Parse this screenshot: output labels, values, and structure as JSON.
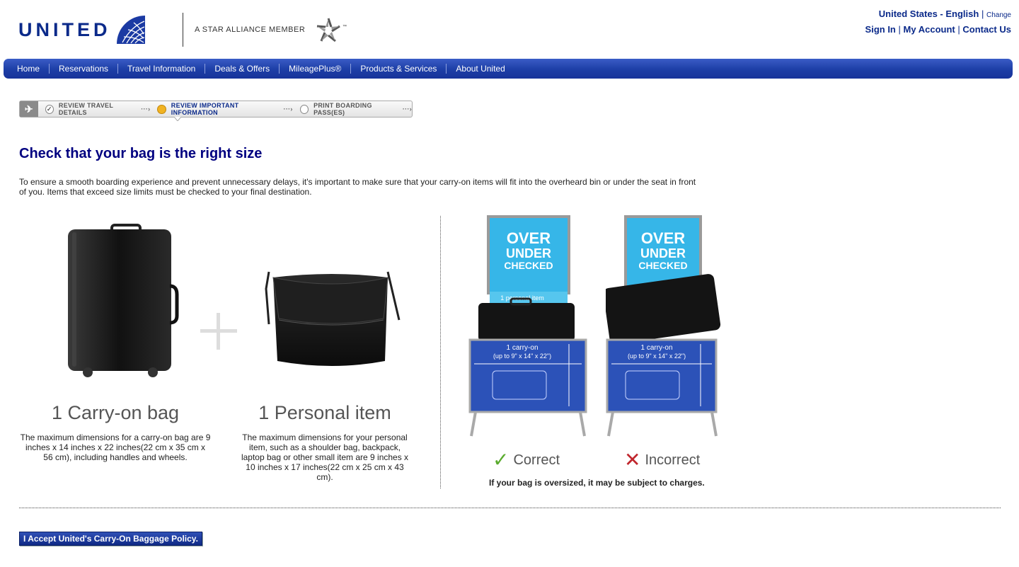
{
  "brand": {
    "name": "UNITED",
    "alliance": "A STAR ALLIANCE MEMBER",
    "tm": "™"
  },
  "top_links": {
    "locale": "United States - English",
    "change": "Change",
    "sign_in": "Sign In",
    "my_account": "My Account",
    "contact_us": "Contact Us",
    "separator": "|"
  },
  "nav": [
    "Home",
    "Reservations",
    "Travel Information",
    "Deals & Offers",
    "MileagePlus®",
    "Products & Services",
    "About United"
  ],
  "progress": {
    "steps": [
      {
        "label": "REVIEW TRAVEL DETAILS",
        "state": "done"
      },
      {
        "label": "REVIEW IMPORTANT INFORMATION",
        "state": "active"
      },
      {
        "label": "PRINT BOARDING PASS(ES)",
        "state": "pending"
      }
    ],
    "arrow": "···›"
  },
  "page": {
    "title": "Check that your bag is the right size",
    "intro": "To ensure a smooth boarding experience and prevent unnecessary delays, it's important to make sure that your carry-on items will fit into the overheard bin or under the seat in front of you. Items that exceed size limits must be checked to your final destination."
  },
  "carry_on": {
    "heading": "1 Carry-on bag",
    "desc": "The maximum dimensions for a carry-on bag are 9 inches x 14 inches x 22 inches(22 cm x 35 cm x 56 cm), including handles and wheels."
  },
  "personal": {
    "heading": "1 Personal item",
    "desc": "The maximum dimensions for your personal item, such as a shoulder bag, backpack, laptop bag or other small item are 9 inches x 10 inches x 17 inches(22 cm x 25 cm x 43 cm)."
  },
  "sizer": {
    "sign_over": "OVER",
    "sign_under": "UNDER",
    "sign_checked": "CHECKED",
    "personal_label": "1 personal item",
    "carry_label": "1 carry-on",
    "carry_dims": "(up to 9\" x 14\" x 22\")",
    "correct": "Correct",
    "incorrect": "Incorrect",
    "note": "If your bag is oversized, it may be subject to charges."
  },
  "accept_button": "I Accept United's Carry-On Baggage Policy.",
  "colors": {
    "brand_blue": "#0b2a8a",
    "nav_blue": "#1d3ea6",
    "title_navy": "#000080",
    "correct_green": "#5aab2e",
    "incorrect_red": "#c0262d"
  }
}
